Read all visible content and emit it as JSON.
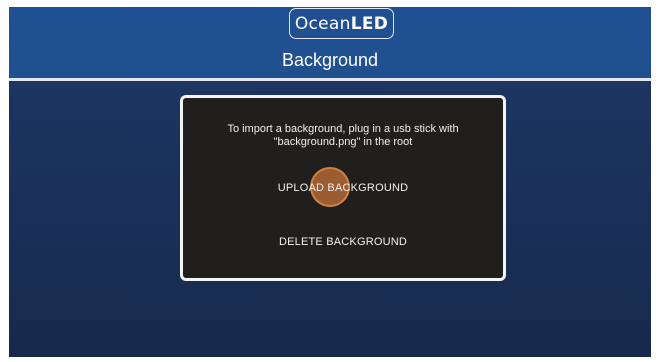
{
  "header": {
    "logo_text_part1": "Ocean",
    "logo_text_part2": "LED",
    "title": "Background"
  },
  "dialog": {
    "message_line1": "To import a background, plug in a usb stick with",
    "message_line2": "\"background.png\" in the root",
    "upload_label": "UPLOAD BACKGROUND",
    "delete_label": "DELETE BACKGROUND"
  },
  "colors": {
    "header": "#21508f",
    "screen_background": "#1c2d4f",
    "dialog_background": "#201f1e",
    "dialog_border": "#f4f4f4",
    "touch_indicator": "#be6e37"
  }
}
